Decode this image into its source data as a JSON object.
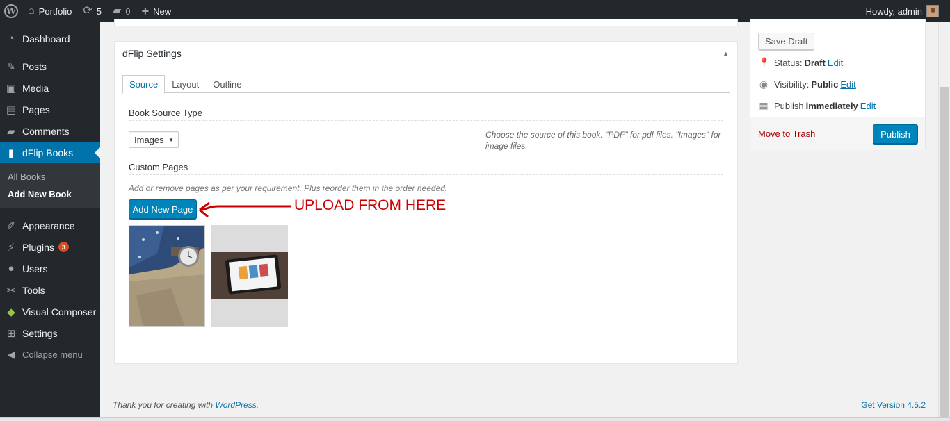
{
  "adminbar": {
    "site_name": "Portfolio",
    "updates_count": "5",
    "comments_count": "0",
    "new_label": "New",
    "howdy": "Howdy, admin"
  },
  "sidebar": {
    "dashboard": "Dashboard",
    "posts": "Posts",
    "media": "Media",
    "pages": "Pages",
    "comments": "Comments",
    "dflip": "dFlip Books",
    "all_books": "All Books",
    "add_new_book": "Add New Book",
    "appearance": "Appearance",
    "plugins": "Plugins",
    "plugins_badge": "3",
    "users": "Users",
    "tools": "Tools",
    "visual_composer": "Visual Composer",
    "settings": "Settings",
    "collapse": "Collapse menu"
  },
  "dflip": {
    "title": "dFlip Settings",
    "tabs": [
      "Source",
      "Layout",
      "Outline"
    ],
    "book_source_type_label": "Book Source Type",
    "source_select_value": "Images",
    "source_help": "Choose the source of this book. \"PDF\" for pdf files. \"Images\" for image files.",
    "custom_pages_label": "Custom Pages",
    "custom_pages_desc": "Add or remove pages as per your requirement. Plus reorder them in the order needed.",
    "add_new_page": "Add New Page",
    "annotation": "UPLOAD FROM HERE"
  },
  "publish": {
    "save_draft": "Save Draft",
    "status_label": "Status:",
    "status_value": "Draft",
    "visibility_label": "Visibility:",
    "visibility_value": "Public",
    "publish_label": "Publish",
    "publish_value": "immediately",
    "edit": "Edit",
    "move_to_trash": "Move to Trash",
    "publish_button": "Publish"
  },
  "footer": {
    "thanks_prefix": "Thank you for creating with ",
    "wordpress": "WordPress",
    "thanks_suffix": ".",
    "version": "Get Version 4.5.2"
  },
  "colors": {
    "accent": "#0073aa",
    "button": "#0085ba",
    "admin_dark": "#23282d",
    "annotation": "#cc0000",
    "trash": "#aa0000"
  }
}
